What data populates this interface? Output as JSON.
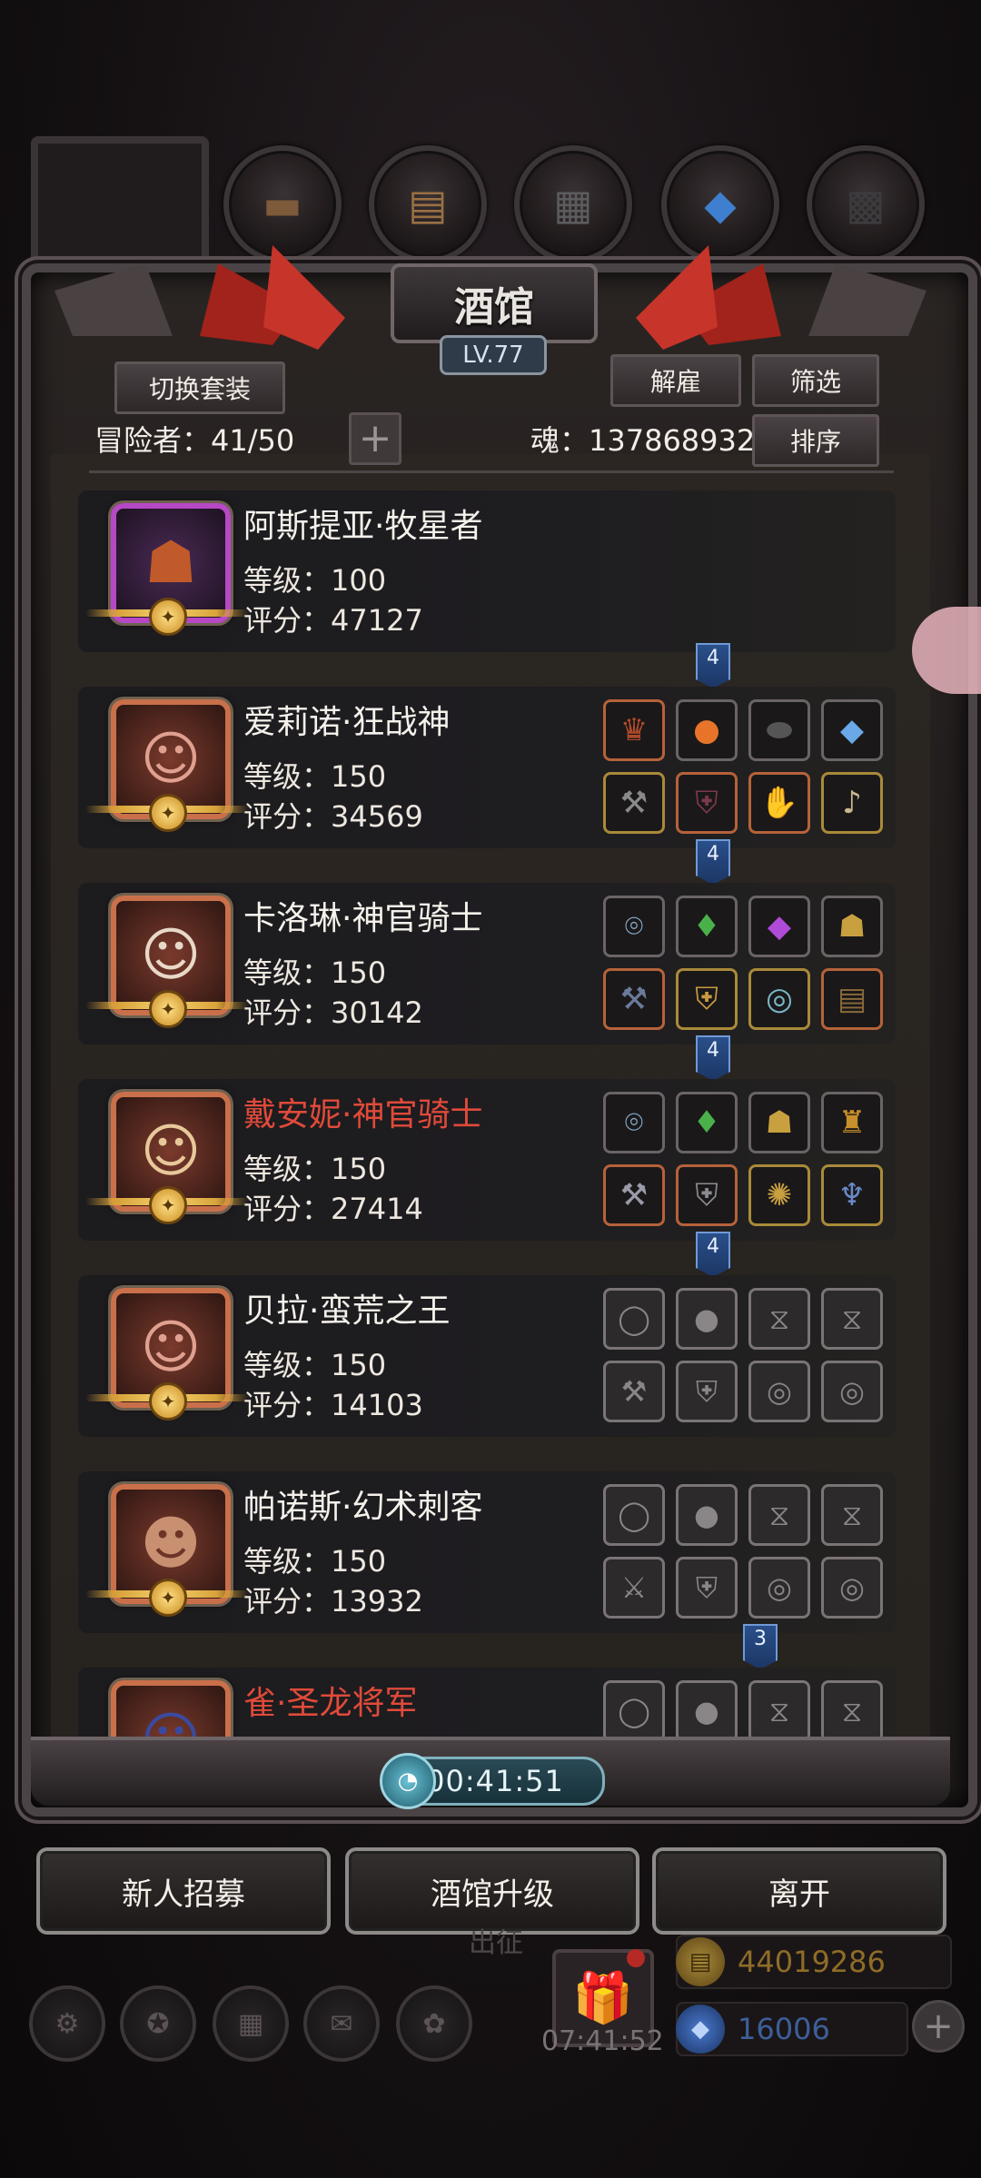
{
  "top_slots": [
    {
      "icon": "brown-leather-icon"
    },
    {
      "icon": "wood-plank-icon"
    },
    {
      "icon": "iron-ingot-icon"
    },
    {
      "icon": "blue-crystal-icon"
    },
    {
      "icon": "dark-ore-icon"
    }
  ],
  "panel": {
    "title": "酒馆",
    "level": "LV.77",
    "switch_set_label": "切换套装",
    "dismiss_label": "解雇",
    "filter_label": "筛选",
    "sort_label": "排序",
    "adventurers_text": "冒险者：41/50",
    "soul_text": "魂：137868932",
    "add_label": "+"
  },
  "heroes": [
    {
      "name": "阿斯提亚·牧星者",
      "level": "等级：100",
      "score": "评分：47127",
      "name_color": "white",
      "frame": "purple",
      "portrait": "hooded-mask",
      "equipped": null
    },
    {
      "name": "爱莉诺·狂战神",
      "level": "等级：150",
      "score": "评分：34569",
      "name_color": "white",
      "frame": "red",
      "portrait": "red-hair-woman",
      "badge": "4",
      "equipment": [
        [
          "helm",
          "orb-fire",
          "stone",
          "blue-gem"
        ],
        [
          "axe",
          "armor",
          "purple-gauntlet",
          "horn"
        ]
      ]
    },
    {
      "name": "卡洛琳·神官骑士",
      "level": "等级：150",
      "score": "评分：30142",
      "name_color": "white",
      "frame": "red",
      "portrait": "nun",
      "badge": "4",
      "equipment": [
        [
          "bracer",
          "green-lantern",
          "purple-gem",
          "lantern"
        ],
        [
          "hammer",
          "golden-armor",
          "blue-ring",
          "book"
        ]
      ]
    },
    {
      "name": "戴安妮·神官骑士",
      "level": "等级：150",
      "score": "评分：27414",
      "name_color": "red",
      "frame": "red",
      "portrait": "blonde-nun",
      "badge": "4",
      "equipment": [
        [
          "bracer",
          "green-lantern",
          "lantern",
          "green-lamp"
        ],
        [
          "hammer",
          "spiked-armor",
          "gold-ring",
          "pendant"
        ]
      ]
    },
    {
      "name": "贝拉·蛮荒之王",
      "level": "等级：150",
      "score": "评分：14103",
      "name_color": "white",
      "frame": "red",
      "portrait": "red-hair-woman",
      "badge": "4",
      "equipment": "empty"
    },
    {
      "name": "帕诺斯·幻术刺客",
      "level": "等级：150",
      "score": "评分：13932",
      "name_color": "white",
      "frame": "red",
      "portrait": "eyepatch-man",
      "equipment": "empty"
    },
    {
      "name": "雀·圣龙将军",
      "name_color": "red",
      "frame": "red",
      "portrait": "blue-hair",
      "badge": "3",
      "equipment": "empty"
    }
  ],
  "timer": "00:41:51",
  "buttons": {
    "recruit": "新人招募",
    "upgrade": "酒馆升级",
    "leave": "离开"
  },
  "hud": {
    "expedition": "出征",
    "clock": "07:41:52",
    "gold": "44019286",
    "gems": "16006"
  },
  "colors": {
    "accent_blue": "#2a4f8a",
    "name_red": "#e04a3a",
    "gold_text": "#8f6c28",
    "gem_text": "#3d5f9a"
  }
}
